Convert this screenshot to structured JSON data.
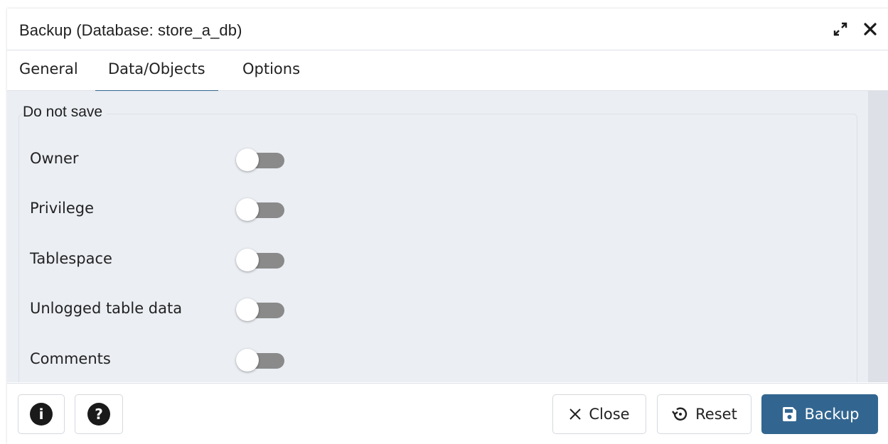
{
  "dialog": {
    "title": "Backup (Database: store_a_db)",
    "icons": {
      "maximize": "expand-icon",
      "close": "close-icon"
    }
  },
  "tabs": [
    {
      "label": "General",
      "active": false
    },
    {
      "label": "Data/Objects",
      "active": true
    },
    {
      "label": "Options",
      "active": false
    }
  ],
  "section": {
    "legend": "Do not save",
    "rows": [
      {
        "label": "Owner",
        "enabled": false
      },
      {
        "label": "Privilege",
        "enabled": false
      },
      {
        "label": "Tablespace",
        "enabled": false
      },
      {
        "label": "Unlogged table data",
        "enabled": false
      },
      {
        "label": "Comments",
        "enabled": false
      }
    ]
  },
  "footer": {
    "info_icon": "info-icon",
    "help_icon": "help-icon",
    "close_label": "Close",
    "reset_label": "Reset",
    "backup_label": "Backup"
  },
  "colors": {
    "accent": "#326690",
    "content_bg": "#ebeef3",
    "toggle_off": "#8a8a8a"
  }
}
